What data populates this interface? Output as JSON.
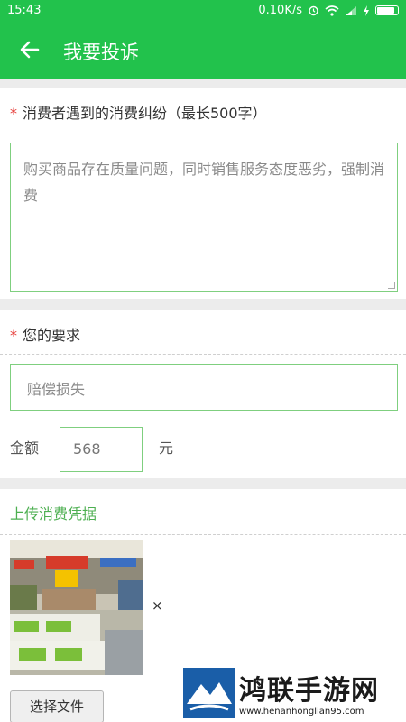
{
  "status_bar": {
    "time": "15:43",
    "speed": "0.10K/s"
  },
  "app_bar": {
    "title": "我要投诉"
  },
  "dispute": {
    "label": "消费者遇到的消费纠纷（最长500字）",
    "text": "购买商品存在质量问题，同时销售服务态度恶劣，强制消费"
  },
  "demand": {
    "label": "您的要求",
    "value": "赔偿损失",
    "amount_label": "金额",
    "amount_value": "568",
    "unit": "元"
  },
  "upload": {
    "title": "上传消费凭据",
    "remove": "×",
    "choose_file": "选择文件"
  },
  "watermark": {
    "brand": "鸿联手游网",
    "url": "www.henanhonglian95.com"
  },
  "colors": {
    "primary": "#22c24c",
    "border": "#7fcf7f",
    "required": "#e53935",
    "upload_title": "#4caf50"
  }
}
